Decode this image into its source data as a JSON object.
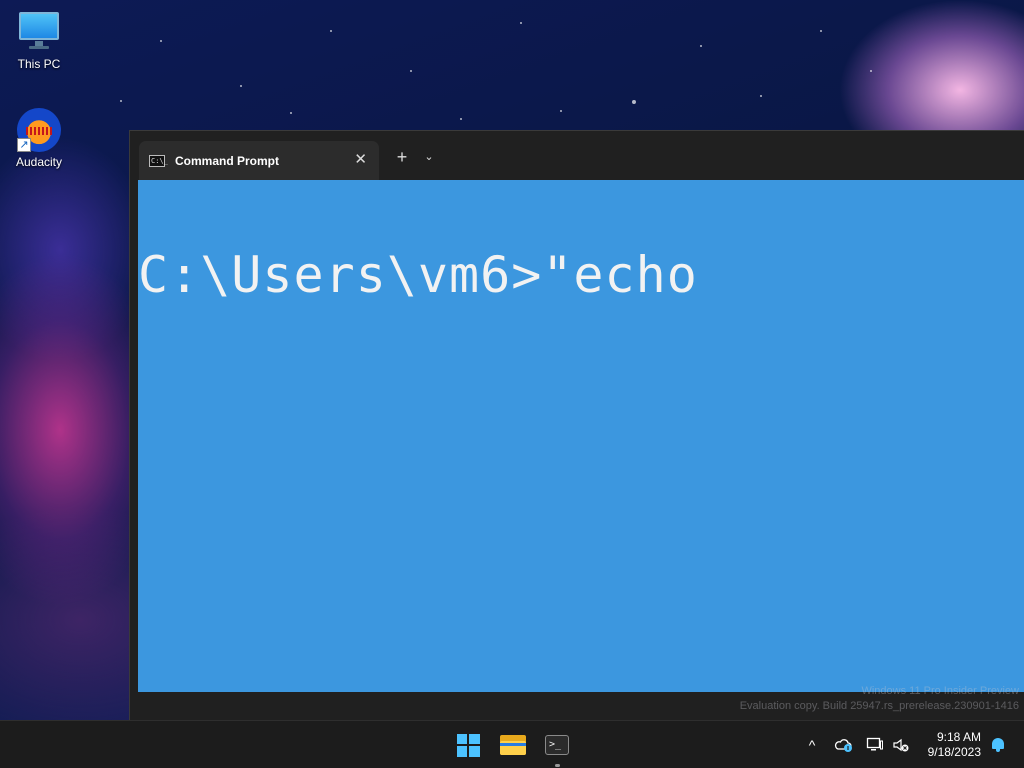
{
  "desktop": {
    "icons": [
      {
        "label": "This PC",
        "icon": "monitor-icon"
      },
      {
        "label": "Audacity",
        "icon": "audacity-icon"
      }
    ]
  },
  "window": {
    "tab": {
      "icon": "cmd-icon",
      "icon_text": "C:\\_",
      "title": "Command Prompt",
      "close": "✕"
    },
    "new_tab": "+",
    "dropdown": "⌄",
    "console": {
      "background": "#3c97df",
      "text_color": "#f2f2f2",
      "prompt_line": "C:\\Users\\vm6>\"echo"
    }
  },
  "watermark": {
    "line1": "Windows 11 Pro Insider Preview",
    "line2": "Evaluation copy. Build 25947.rs_prerelease.230901-1416"
  },
  "taskbar": {
    "apps": [
      {
        "name": "start",
        "icon": "windows-logo-icon"
      },
      {
        "name": "file-explorer",
        "icon": "folder-icon"
      },
      {
        "name": "terminal",
        "icon": "terminal-icon",
        "running": true
      }
    ],
    "tray": {
      "overflow": "^",
      "icons": [
        "onedrive-cloud-icon",
        "network-icon",
        "volume-muted-icon"
      ],
      "time": "9:18 AM",
      "date": "9/18/2023",
      "notification_icon": "bell-icon"
    },
    "accent": "#4cc2ff"
  }
}
